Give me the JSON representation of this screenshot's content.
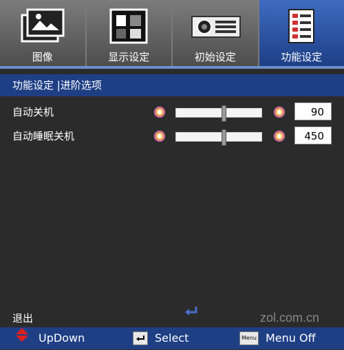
{
  "tabs": [
    {
      "label": "图像",
      "icon": "picture-icon",
      "active": false
    },
    {
      "label": "显示设定",
      "icon": "display-pattern-icon",
      "active": false
    },
    {
      "label": "初始设定",
      "icon": "projector-icon",
      "active": false
    },
    {
      "label": "功能设定",
      "icon": "checklist-icon",
      "active": true
    }
  ],
  "breadcrumb": "功能设定 |进阶选项",
  "settings": [
    {
      "label": "自动关机",
      "value": "90"
    },
    {
      "label": "自动睡眠关机",
      "value": "450"
    }
  ],
  "exit_label": "退出",
  "footer": {
    "updown": "UpDown",
    "select": "Select",
    "menu": "Menu Off",
    "menu_key": "Menu"
  },
  "watermark": "zol.com.cn",
  "colors": {
    "accent": "#1f3f85",
    "active_tab": "#2f56a8"
  }
}
